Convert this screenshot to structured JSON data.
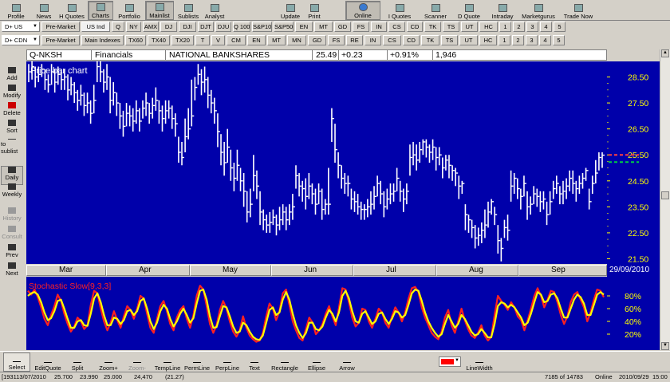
{
  "toolbar": {
    "buttons": [
      "Profile",
      "News",
      "H Quotes",
      "Charts",
      "Portfolio",
      "Mainlist",
      "Sublists",
      "Analyst",
      "Update",
      "Print",
      "Online",
      "I Quotes",
      "Scanner",
      "D Quote",
      "Intraday",
      "Marketgurus",
      "Trade Now"
    ],
    "icons": [
      "profile-icon",
      "news-icon",
      "history-quotes-icon",
      "charts-icon",
      "portfolio-icon",
      "mainlist-icon",
      "sublists-icon",
      "analyst-icon",
      "update-icon",
      "print-icon",
      "online-globe-icon",
      "index-quotes-icon",
      "scanner-icon",
      "depth-quote-icon",
      "intraday-icon",
      "marketgurus-icon",
      "trade-now-icon"
    ]
  },
  "tabs1": {
    "dropdown": "D+ US",
    "items": [
      "Pre-Market",
      "US Ind",
      "Q",
      "NY",
      "AMX",
      "DJ",
      "DJI",
      "DJT",
      "DJU",
      "Q 100",
      "S&P100",
      "S&P500",
      "EN",
      "MT",
      "GD",
      "FS",
      "IN",
      "CS",
      "CD",
      "TK",
      "TS",
      "UT",
      "HC",
      "1",
      "2",
      "3",
      "4",
      "5"
    ]
  },
  "tabs2": {
    "dropdown": "D+ CDN",
    "items": [
      "Pre-Market",
      "Main Indexes",
      "TX60",
      "TX40",
      "TX20",
      "T",
      "V",
      "CM",
      "EN",
      "MT",
      "MN",
      "GD",
      "FS",
      "RE",
      "IN",
      "CS",
      "CD",
      "TK",
      "TS",
      "UT",
      "HC",
      "1",
      "2",
      "3",
      "4",
      "5"
    ]
  },
  "sidebar": {
    "buttons": [
      "Add",
      "Modify",
      "Delete",
      "Sort",
      "to sublist",
      "Daily",
      "Weekly",
      "History",
      "Consult",
      "Prev",
      "Next"
    ],
    "icons": [
      "add-icon",
      "modify-icon",
      "delete-icon",
      "sort-icon",
      "sublist-icon",
      "daily-icon",
      "weekly-icon",
      "history-icon",
      "consult-icon",
      "prev-icon",
      "next-icon"
    ]
  },
  "info": {
    "symbol": "Q-NKSH",
    "sector": "Financials",
    "name": "NATIONAL BANKSHARES",
    "price": "25.49",
    "change": "+0.23",
    "pct": "+0.91%",
    "volume": "1,946"
  },
  "price_chart": {
    "title": "Price bar chart",
    "y_ticks": [
      "28.50",
      "27.50",
      "26.50",
      "25.50",
      "24.50",
      "23.50",
      "22.50",
      "21.50"
    ],
    "current_price": "25.50",
    "months": [
      "Mar",
      "Apr",
      "May",
      "Jun",
      "Jul",
      "Aug",
      "Sep"
    ],
    "date": "29/09/2010"
  },
  "stoch_chart": {
    "title": "Stochastic Slow[9,3,3]",
    "y_ticks": [
      "80%",
      "60%",
      "40%",
      "20%"
    ]
  },
  "chart_data": [
    {
      "type": "bar",
      "title": "Price bar chart",
      "ylim": [
        21.3,
        29.1
      ],
      "x_labels": [
        "Mar",
        "Apr",
        "May",
        "Jun",
        "Jul",
        "Aug",
        "Sep"
      ],
      "grid": false,
      "legend": "none",
      "close": [
        28.7,
        28.9,
        28.5,
        28.6,
        28.8,
        28.4,
        28.2,
        28.7,
        28.3,
        28.6,
        28.4,
        28.5,
        28.0,
        28.2,
        27.9,
        27.6,
        27.8,
        27.4,
        27.5,
        27.1,
        27.6,
        28.9,
        28.7,
        28.3,
        28.5,
        27.6,
        27.9,
        27.5,
        27.0,
        26.6,
        27.1,
        27.0,
        26.8,
        27.2,
        26.8,
        27.3,
        27.5,
        27.1,
        27.4,
        27.6,
        27.2,
        26.9,
        27.2,
        27.3,
        26.9,
        26.7,
        25.6,
        25.4,
        26.2,
        26.5,
        27.0,
        28.1,
        28.6,
        28.3,
        28.4,
        27.8,
        27.5,
        27.2,
        26.4,
        25.6,
        25.2,
        25.8,
        25.0,
        24.6,
        25.1,
        24.5,
        24.1,
        23.3,
        23.6,
        24.7,
        24.3,
        23.3,
        23.0,
        22.8,
        22.9,
        23.1,
        22.8,
        23.0,
        23.3,
        23.0,
        23.3,
        23.5,
        24.7,
        24.3,
        24.2,
        23.9,
        24.3,
        24.0,
        23.6,
        24.1,
        23.4,
        23.6,
        23.6,
        26.9,
        25.7,
        25.1,
        24.6,
        24.4,
        24.4,
        23.8,
        23.7,
        23.5,
        23.4,
        23.4,
        23.5,
        23.6,
        23.9,
        24.4,
        24.0,
        23.5,
        23.8,
        24.0,
        24.1,
        24.6,
        24.1,
        23.8,
        24.1,
        25.4,
        25.5,
        25.3,
        25.7,
        26.0,
        25.8,
        25.6,
        25.8,
        25.4,
        25.5,
        25.0,
        25.3,
        25.1,
        24.9,
        24.8,
        24.3,
        24.4,
        23.2,
        23.0,
        22.7,
        22.3,
        22.4,
        22.6,
        22.8,
        23.3,
        23.7,
        23.2,
        22.2,
        21.9,
        22.7,
        22.6,
        24.3,
        24.6,
        24.2,
        23.9,
        24.4,
        23.5,
        23.6,
        24.0,
        23.9,
        23.7,
        23.8,
        23.2,
        23.7,
        24.2,
        24.4,
        24.0,
        24.1,
        24.3,
        24.6,
        24.4,
        24.2,
        24.4,
        24.6,
        24.9,
        23.7,
        24.4,
        24.8,
        25.4,
        25.49
      ],
      "high": [
        29.0,
        29.1,
        28.9,
        28.9,
        29.0,
        28.8,
        28.6,
        29.0,
        28.8,
        28.9,
        28.8,
        28.8,
        28.6,
        28.5,
        28.3,
        28.0,
        28.2,
        27.9,
        27.9,
        27.6,
        28.2,
        29.1,
        29.1,
        28.8,
        29.0,
        28.5,
        28.3,
        27.9,
        27.5,
        27.2,
        27.5,
        27.4,
        27.3,
        27.6,
        27.3,
        27.6,
        27.9,
        27.5,
        27.7,
        28.1,
        27.6,
        27.4,
        27.6,
        27.6,
        27.4,
        27.1,
        26.2,
        26.0,
        26.9,
        27.3,
        28.4,
        28.5,
        29.0,
        28.8,
        28.9,
        28.5,
        28.0,
        27.7,
        27.1,
        26.3,
        26.0,
        26.5,
        25.7,
        25.2,
        25.7,
        25.0,
        24.8,
        24.1,
        24.2,
        25.5,
        24.9,
        24.1,
        23.4,
        23.2,
        23.3,
        23.4,
        23.2,
        23.5,
        23.6,
        23.5,
        23.6,
        24.0,
        25.1,
        24.8,
        24.5,
        24.6,
        24.8,
        24.4,
        24.2,
        24.4,
        24.2,
        23.8,
        25.0,
        27.3,
        26.7,
        25.6,
        25.1,
        24.8,
        24.7,
        24.2,
        24.1,
        24.0,
        23.7,
        23.6,
        23.8,
        24.1,
        24.3,
        24.7,
        24.5,
        24.1,
        24.2,
        24.4,
        24.4,
        25.0,
        24.5,
        24.2,
        24.4,
        25.9,
        26.0,
        25.9,
        26.0,
        26.1,
        26.1,
        25.9,
        26.1,
        25.8,
        25.8,
        25.4,
        25.5,
        25.5,
        25.1,
        25.0,
        24.7,
        24.5,
        23.6,
        23.2,
        23.0,
        22.8,
        22.7,
        22.9,
        23.4,
        23.7,
        23.8,
        23.5,
        22.8,
        22.3,
        23.0,
        23.2,
        24.9,
        24.8,
        24.6,
        24.2,
        24.7,
        24.1,
        23.9,
        24.3,
        24.2,
        24.1,
        24.1,
        23.7,
        24.1,
        24.5,
        24.7,
        24.3,
        24.5,
        24.6,
        24.9,
        24.9,
        24.5,
        24.7,
        24.8,
        25.0,
        24.2,
        24.7,
        25.3,
        25.6,
        25.6
      ],
      "low": [
        28.3,
        28.4,
        28.1,
        28.3,
        28.5,
        28.0,
        27.9,
        28.2,
        27.9,
        28.2,
        28.0,
        28.0,
        27.6,
        27.8,
        27.5,
        27.2,
        27.4,
        27.0,
        27.1,
        26.7,
        27.1,
        28.3,
        28.3,
        27.9,
        28.0,
        27.1,
        27.4,
        27.0,
        26.5,
        26.2,
        26.6,
        26.6,
        26.4,
        26.7,
        26.4,
        26.9,
        27.0,
        26.7,
        26.9,
        27.2,
        26.7,
        26.4,
        26.7,
        26.9,
        26.5,
        26.2,
        25.2,
        25.1,
        25.6,
        26.1,
        26.6,
        27.6,
        28.2,
        27.8,
        27.9,
        27.3,
        27.1,
        26.7,
        25.8,
        25.1,
        24.7,
        25.2,
        24.5,
        24.1,
        24.5,
        24.1,
        23.5,
        22.9,
        23.1,
        24.1,
        23.8,
        22.8,
        22.6,
        22.5,
        22.5,
        22.8,
        22.4,
        22.6,
        22.8,
        22.6,
        22.8,
        23.0,
        24.2,
        23.9,
        23.7,
        23.4,
        23.8,
        23.6,
        23.2,
        23.6,
        23.0,
        23.2,
        23.2,
        26.0,
        25.2,
        24.6,
        24.2,
        24.0,
        23.9,
        23.4,
        23.3,
        23.2,
        23.0,
        23.0,
        23.1,
        23.2,
        23.4,
        23.9,
        23.6,
        23.1,
        23.4,
        23.6,
        23.7,
        24.1,
        23.7,
        23.3,
        23.6,
        24.7,
        25.1,
        24.9,
        25.2,
        25.5,
        25.4,
        25.2,
        25.3,
        24.9,
        25.1,
        24.6,
        24.9,
        24.6,
        24.5,
        24.3,
        23.8,
        24.0,
        22.6,
        22.5,
        22.3,
        21.9,
        22.0,
        22.1,
        22.3,
        22.7,
        23.2,
        22.8,
        21.7,
        21.4,
        22.3,
        22.2,
        23.7,
        24.0,
        23.8,
        23.4,
        23.9,
        23.0,
        23.2,
        23.6,
        23.5,
        23.3,
        23.4,
        22.8,
        23.2,
        23.8,
        24.0,
        23.6,
        23.6,
        23.8,
        24.1,
        24.0,
        23.7,
        24.0,
        24.2,
        24.5,
        23.4,
        24.0,
        24.4,
        24.9,
        25.0
      ]
    },
    {
      "type": "line",
      "title": "Stochastic Slow[9,3,3]",
      "ylim": [
        0,
        100
      ],
      "y_ticks": [
        "80%",
        "60%",
        "40%",
        "20%"
      ],
      "legend": "none",
      "series": [
        {
          "color": "#ff2020",
          "values": [
            88,
            82,
            90,
            78,
            62,
            44,
            34,
            50,
            64,
            82,
            72,
            52,
            36,
            24,
            32,
            46,
            40,
            28,
            34,
            66,
            88,
            84,
            60,
            40,
            26,
            38,
            56,
            42,
            30,
            48,
            64,
            58,
            44,
            60,
            80,
            76,
            52,
            30,
            22,
            44,
            64,
            72,
            56,
            36,
            26,
            46,
            58,
            64,
            44,
            30,
            50,
            80,
            96,
            90,
            64,
            36,
            22,
            34,
            58,
            72,
            60,
            40,
            24,
            16,
            26,
            48,
            30,
            18,
            12,
            8,
            10,
            22,
            48,
            68,
            60,
            42,
            56,
            84,
            90,
            66,
            40,
            26,
            14,
            10,
            28,
            46,
            38,
            20,
            26,
            36,
            52,
            64,
            48,
            34,
            62,
            92,
            90,
            70,
            46,
            32,
            38,
            60,
            58,
            40,
            30,
            44,
            60,
            54,
            38,
            30,
            48,
            62,
            54,
            40,
            54,
            76,
            92,
            94,
            86,
            62,
            46,
            34,
            22,
            16,
            12,
            24,
            46,
            58,
            34,
            22,
            40,
            60,
            42,
            28,
            18,
            14,
            22,
            34,
            18,
            10,
            16,
            50,
            80,
            72,
            66,
            58,
            70,
            62,
            48,
            42,
            26,
            42,
            60,
            80,
            92,
            80,
            62,
            74,
            88,
            86,
            70,
            50,
            36,
            48,
            70,
            82,
            86,
            74,
            62,
            40,
            54,
            74,
            90,
            88,
            78
          ]
        },
        {
          "color": "#ffff00",
          "values": [
            80,
            84,
            86,
            82,
            70,
            54,
            42,
            45,
            56,
            72,
            74,
            60,
            44,
            30,
            30,
            40,
            42,
            34,
            33,
            52,
            76,
            84,
            70,
            50,
            34,
            34,
            46,
            44,
            36,
            42,
            56,
            58,
            50,
            56,
            72,
            76,
            60,
            40,
            28,
            38,
            56,
            66,
            60,
            44,
            32,
            40,
            52,
            60,
            50,
            38,
            45,
            68,
            88,
            90,
            74,
            48,
            30,
            31,
            48,
            64,
            62,
            48,
            32,
            22,
            24,
            38,
            34,
            24,
            16,
            12,
            11,
            18,
            38,
            58,
            62,
            50,
            54,
            74,
            86,
            74,
            52,
            34,
            22,
            14,
            22,
            38,
            38,
            28,
            26,
            32,
            46,
            58,
            52,
            40,
            54,
            80,
            88,
            76,
            56,
            40,
            38,
            52,
            56,
            46,
            36,
            40,
            52,
            54,
            44,
            36,
            44,
            56,
            54,
            46,
            50,
            66,
            84,
            90,
            88,
            72,
            54,
            40,
            30,
            22,
            16,
            20,
            36,
            50,
            40,
            30,
            36,
            50,
            44,
            34,
            24,
            18,
            20,
            28,
            22,
            15,
            15,
            36,
            64,
            70,
            68,
            62,
            66,
            62,
            54,
            46,
            34,
            38,
            52,
            70,
            86,
            82,
            70,
            72,
            82,
            84,
            76,
            60,
            46,
            46,
            60,
            74,
            82,
            78,
            68,
            50,
            50,
            66,
            82,
            86,
            82
          ]
        }
      ]
    }
  ],
  "drawbar": {
    "buttons": [
      "Select",
      "EditQuote",
      "Split",
      "Zoom+",
      "Zoom-",
      "TempLine",
      "PermLine",
      "PerpLine",
      "Text",
      "Rectangle",
      "Ellipse",
      "Arrow",
      "LineWidth"
    ],
    "icons": [
      "select-cursor-icon",
      "edit-quote-icon",
      "split-icon",
      "zoom-in-icon",
      "zoom-out-icon",
      "temp-line-icon",
      "perm-line-icon",
      "perp-line-icon",
      "text-tool-icon",
      "rectangle-tool-icon",
      "ellipse-tool-icon",
      "arrow-tool-icon",
      "line-width-icon"
    ],
    "color_swatch": "#ff0000"
  },
  "status": {
    "left": "[193113/07/2010",
    "open": "25.700",
    "low": "23.990",
    "high": "25.000",
    "change": "24,470",
    "pct": "(21.27)",
    "record": "7185 of 14783",
    "mode": "Online",
    "datetime": "2010/09/29",
    "time": "15:00"
  },
  "colors": {
    "panel": "#0000aa",
    "bars": "#ffffff",
    "axis_tick": "#ffff00",
    "stoch_fast": "#ff2020",
    "stoch_slow": "#ffff00",
    "current_marker": "#ff4040",
    "prev_marker": "#00cc44"
  }
}
